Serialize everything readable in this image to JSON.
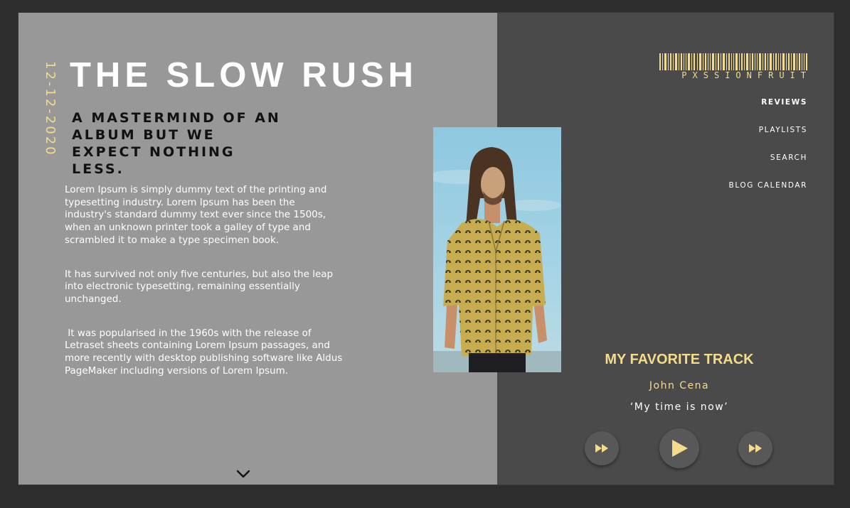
{
  "date": "12-12-2020",
  "title": "THE SLOW RUSH",
  "subtitle": "A MASTERMIND OF AN ALBUM BUT WE EXPECT NOTHING LESS.",
  "paragraphs": [
    "Lorem Ipsum is simply dummy text of the printing and typesetting industry. Lorem Ipsum has been the industry's standard dummy text ever since the 1500s, when an unknown printer took a galley of type and scrambled it to make a type specimen book.",
    "It has survived not only five centuries, but also the leap into electronic typesetting, remaining essentially unchanged.",
    " It was popularised in the 1960s with the release of Letraset sheets containing Lorem Ipsum passages, and more recently with desktop publishing software like Aldus PageMaker including versions of Lorem Ipsum."
  ],
  "brand": "PXSSIONFRUIT",
  "nav": {
    "items": [
      {
        "label": "REVIEWS",
        "active": true
      },
      {
        "label": "PLAYLISTS",
        "active": false
      },
      {
        "label": "SEARCH",
        "active": false
      },
      {
        "label": "BLOG CALENDAR",
        "active": false
      }
    ]
  },
  "track": {
    "heading": "MY FAVORITE TRACK",
    "artist": "John Cena",
    "song": "‘My time is now’"
  },
  "controls": {
    "prev_icon": "fast-forward-icon",
    "play_icon": "play-icon",
    "next_icon": "fast-forward-icon"
  },
  "colors": {
    "accent": "#f5dc8a",
    "left_panel": "#989898",
    "right_panel": "#4a4a4a",
    "background": "#2d2d2d"
  }
}
